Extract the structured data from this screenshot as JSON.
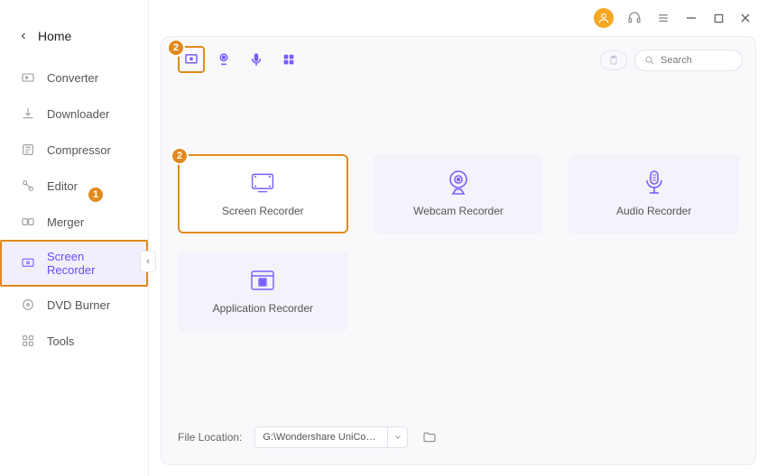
{
  "titlebar": {
    "avatar": "user"
  },
  "sidebar": {
    "home": "Home",
    "items": [
      {
        "label": "Converter",
        "icon": "converter"
      },
      {
        "label": "Downloader",
        "icon": "downloader"
      },
      {
        "label": "Compressor",
        "icon": "compressor"
      },
      {
        "label": "Editor",
        "icon": "editor"
      },
      {
        "label": "Merger",
        "icon": "merger"
      },
      {
        "label": "Screen Recorder",
        "icon": "screen-recorder"
      },
      {
        "label": "DVD Burner",
        "icon": "dvd-burner"
      },
      {
        "label": "Tools",
        "icon": "tools"
      }
    ],
    "badge1": "1"
  },
  "toolbar": {
    "badge2": "2"
  },
  "search": {
    "placeholder": "Search"
  },
  "cards": [
    {
      "label": "Screen Recorder",
      "badge": "2"
    },
    {
      "label": "Webcam Recorder"
    },
    {
      "label": "Audio Recorder"
    },
    {
      "label": "Application Recorder"
    }
  ],
  "footer": {
    "label": "File Location:",
    "path": "G:\\Wondershare UniConverter "
  },
  "colors": {
    "accent": "#7b5cff",
    "highlight": "#e08a1e"
  }
}
